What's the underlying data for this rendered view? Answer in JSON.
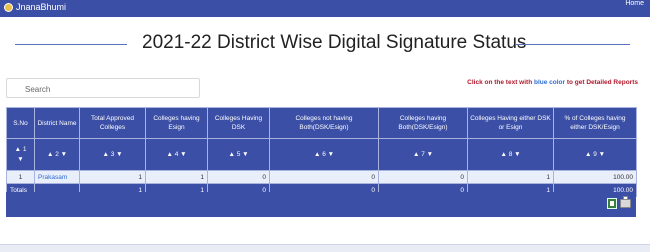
{
  "header": {
    "app_name": "JnanaBhumi",
    "home_link": "Home"
  },
  "page_title": "2021-22 District Wise Digital Signature Status",
  "search": {
    "placeholder": "Search"
  },
  "info_note": {
    "prefix": "Click on the text with ",
    "highlight": "blue color",
    "suffix": " to get Detailed Reports"
  },
  "table": {
    "columns": [
      "S.No",
      "District Name",
      "Total Approved Colleges",
      "Colleges having Esign",
      "Colleges Having DSK",
      "Colleges not having Both(DSK/Esign)",
      "Colleges having Both(DSK/Esign)",
      "Colleges Having either DSK or Esign",
      "% of Colleges having either DSK/Esign"
    ],
    "sort_labels": [
      "1",
      "2",
      "3",
      "4",
      "5",
      "6",
      "7",
      "8",
      "9"
    ],
    "rows": [
      {
        "sno": "1",
        "district": "Prakasam",
        "total": "1",
        "esign": "1",
        "dsk": "0",
        "not_both": "0",
        "both": "0",
        "either": "1",
        "percent": "100.00"
      }
    ],
    "totals": {
      "label": "Totals",
      "total": "1",
      "esign": "1",
      "dsk": "0",
      "not_both": "0",
      "both": "0",
      "either": "1",
      "percent": "100.00"
    }
  },
  "icons": {
    "logo": "jnanabhumi-logo-icon",
    "export": "excel-export-icon",
    "print": "print-icon"
  }
}
